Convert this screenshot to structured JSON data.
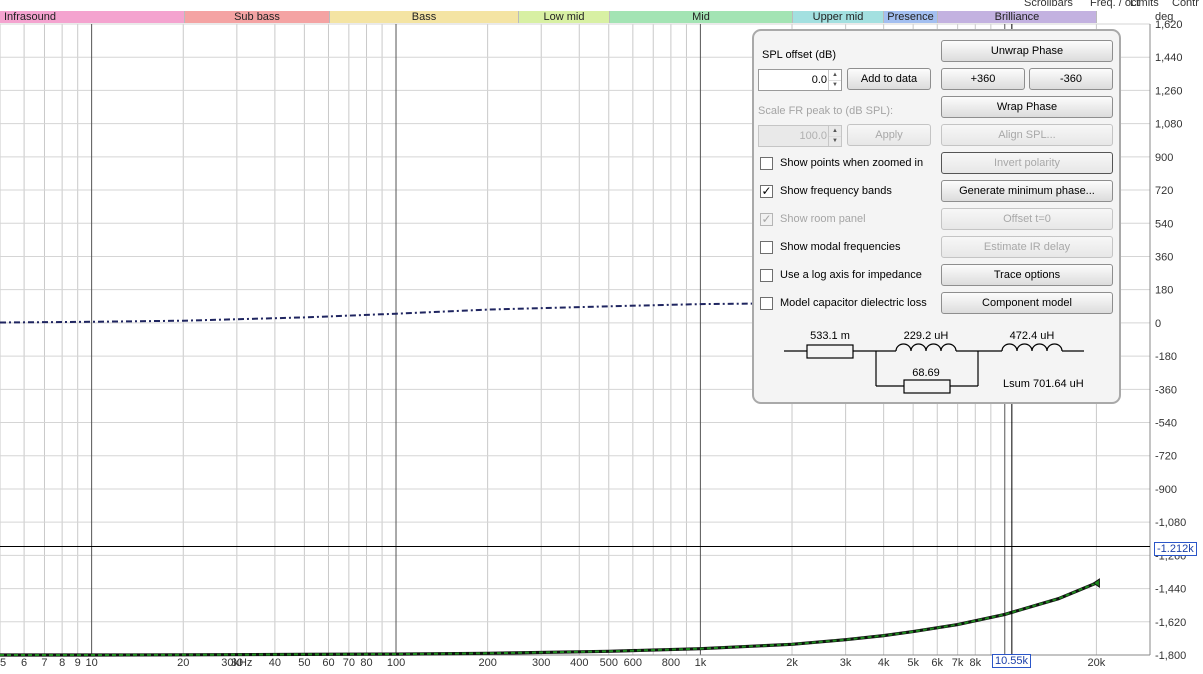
{
  "header_right": {
    "items": [
      "Scrollbars",
      "Freq. / oct",
      "Limits",
      "Contr"
    ]
  },
  "bands": [
    {
      "label": "Infrasound",
      "color": "#f4a3cf"
    },
    {
      "label": "Sub bass",
      "color": "#f4a3a3"
    },
    {
      "label": "Bass",
      "color": "#f4e4a3"
    },
    {
      "label": "Low mid",
      "color": "#d8f0a3"
    },
    {
      "label": "Mid",
      "color": "#a3e4b4"
    },
    {
      "label": "Upper mid",
      "color": "#a3e0e0"
    },
    {
      "label": "Presence",
      "color": "#a3bff0"
    },
    {
      "label": "Brilliance",
      "color": "#c3b2e0"
    }
  ],
  "y_axis": {
    "unit": "deg",
    "ticks": [
      "1,620",
      "1,440",
      "1,260",
      "1,080",
      "900",
      "720",
      "540",
      "360",
      "180",
      "0",
      "-180",
      "-360",
      "-540",
      "-720",
      "-900",
      "-1,080",
      "-1,260",
      "-1,440",
      "-1,620",
      "-1,800"
    ],
    "cursor_readout": "-1.212k"
  },
  "x_axis": {
    "ticks": [
      "5",
      "6",
      "7",
      "8",
      "9",
      "10",
      "20",
      "30",
      "40",
      "50",
      "60",
      "70",
      "80",
      "100",
      "200",
      "300",
      "400",
      "500",
      "600",
      "800",
      "1k",
      "2k",
      "3k",
      "4k",
      "5k",
      "6k",
      "7k",
      "8k",
      "20k",
      "30kHz"
    ],
    "cursor_readout": "10.55k"
  },
  "chart_data": {
    "type": "line",
    "xlabel": "",
    "ylabel": "deg",
    "x_scale": "log",
    "xlim": [
      5,
      30000
    ],
    "ylim": [
      -1800,
      1620
    ],
    "grid": true,
    "series": [
      {
        "color": "#1f2560",
        "style": "dash-dot",
        "x": [
          5,
          10,
          20,
          50,
          100,
          200,
          500,
          1000,
          2000,
          5000,
          10000,
          20000
        ],
        "y": [
          2,
          6,
          12,
          30,
          50,
          72,
          90,
          102,
          106,
          108,
          109,
          110
        ]
      },
      {
        "color": "#1f8a1f",
        "style": "solid-dashed",
        "x": [
          5,
          10,
          20,
          50,
          100,
          200,
          500,
          1000,
          2000,
          3000,
          4000,
          5000,
          7000,
          10000,
          15000,
          20000
        ],
        "y": [
          -1800,
          -1800,
          -1799,
          -1797,
          -1795,
          -1791,
          -1780,
          -1766,
          -1742,
          -1717,
          -1695,
          -1673,
          -1635,
          -1580,
          -1495,
          -1410
        ]
      }
    ],
    "cursor": {
      "x": 10550,
      "y": -1212
    }
  },
  "panel": {
    "spl_offset_label": "SPL offset (dB)",
    "spl_offset_value": "0.0",
    "add_to_data": "Add to data",
    "scale_label": "Scale FR peak to (dB SPL):",
    "scale_value": "100.0",
    "apply": "Apply",
    "checkboxes": [
      {
        "label": "Show points when zoomed in",
        "checked": false,
        "disabled": false
      },
      {
        "label": "Show frequency bands",
        "checked": true,
        "disabled": false
      },
      {
        "label": "Show room panel",
        "checked": true,
        "disabled": true
      },
      {
        "label": "Show modal frequencies",
        "checked": false,
        "disabled": false
      },
      {
        "label": "Use a log axis for impedance",
        "checked": false,
        "disabled": false
      },
      {
        "label": "Model capacitor dielectric loss",
        "checked": false,
        "disabled": false
      }
    ],
    "unwrap_phase": "Unwrap Phase",
    "plus360": "+360",
    "minus360": "-360",
    "wrap_phase": "Wrap Phase",
    "align_spl": "Align SPL...",
    "invert_polarity": "Invert polarity",
    "generate_min_phase": "Generate minimum phase...",
    "offset_t0": "Offset t=0",
    "estimate_ir_delay": "Estimate IR delay",
    "trace_options": "Trace options",
    "component_model": "Component model",
    "circuit": {
      "r1": "533.1 m",
      "l1": "229.2 uH",
      "l2": "472.4 uH",
      "r2": "68.69",
      "lsum": "Lsum 701.64 uH"
    }
  }
}
